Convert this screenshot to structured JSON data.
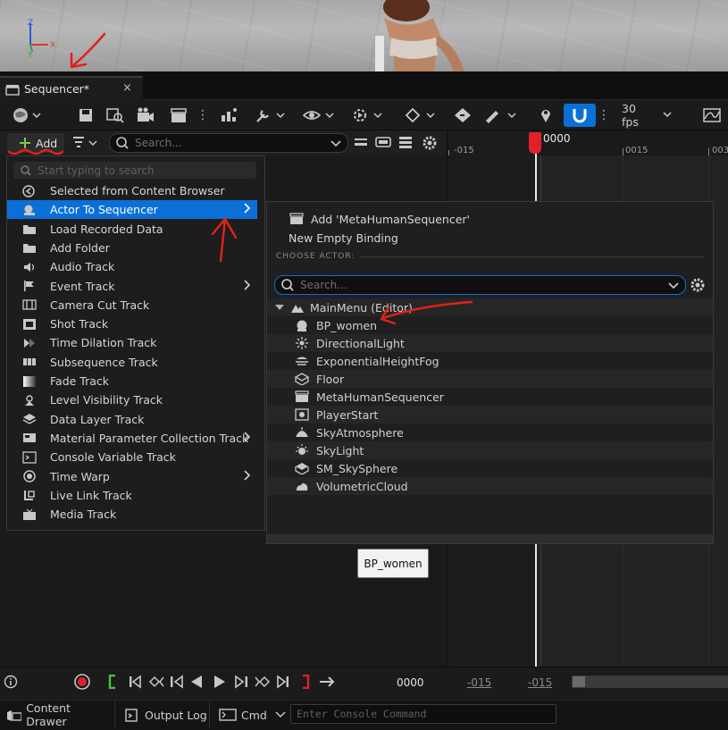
{
  "tab": {
    "title": "Sequencer*",
    "close": "×"
  },
  "toolbar": {
    "fps": "30 fps"
  },
  "filter_bar": {
    "add_label": "Add",
    "search_placeholder": "Search..."
  },
  "timeline": {
    "current_frame": "0000",
    "ruler_ticks": [
      "-015",
      "0015",
      "003"
    ]
  },
  "add_menu": {
    "search_placeholder": "Start typing to search",
    "items": [
      {
        "label": "Selected from Content Browser",
        "icon": "content-browser-icon",
        "submenu": false
      },
      {
        "label": "Actor To Sequencer",
        "icon": "actor-icon",
        "submenu": true
      },
      {
        "label": "Load Recorded Data",
        "icon": "folder-icon",
        "submenu": false
      },
      {
        "label": "Add Folder",
        "icon": "folder-icon",
        "submenu": false
      },
      {
        "label": "Audio Track",
        "icon": "speaker-icon",
        "submenu": false
      },
      {
        "label": "Event Track",
        "icon": "flag-icon",
        "submenu": true
      },
      {
        "label": "Camera Cut Track",
        "icon": "camera-cut-icon",
        "submenu": false
      },
      {
        "label": "Shot Track",
        "icon": "film-icon",
        "submenu": false
      },
      {
        "label": "Time Dilation Track",
        "icon": "time-dilation-icon",
        "submenu": false
      },
      {
        "label": "Subsequence Track",
        "icon": "subsequence-icon",
        "submenu": false
      },
      {
        "label": "Fade Track",
        "icon": "fade-icon",
        "submenu": false
      },
      {
        "label": "Level Visibility Track",
        "icon": "level-visibility-icon",
        "submenu": false
      },
      {
        "label": "Data Layer Track",
        "icon": "layers-icon",
        "submenu": false
      },
      {
        "label": "Material Parameter Collection Track",
        "icon": "material-icon",
        "submenu": true
      },
      {
        "label": "Console Variable Track",
        "icon": "console-icon",
        "submenu": false
      },
      {
        "label": "Time Warp",
        "icon": "clock-icon",
        "submenu": true
      },
      {
        "label": "Live Link Track",
        "icon": "live-link-icon",
        "submenu": false
      },
      {
        "label": "Media Track",
        "icon": "tv-icon",
        "submenu": false
      }
    ]
  },
  "actor_menu": {
    "add_sequence": "Add 'MetaHumanSequencer'",
    "new_binding": "New Empty Binding",
    "choose_actor_header": "CHOOSE ACTOR:",
    "search_placeholder": "Search...",
    "group": "MainMenu (Editor)",
    "actors": [
      "BP_women",
      "DirectionalLight",
      "ExponentialHeightFog",
      "Floor",
      "MetaHumanSequencer",
      "PlayerStart",
      "SkyAtmosphere",
      "SkyLight",
      "SM_SkySphere",
      "VolumetricCloud"
    ]
  },
  "tooltip": "BP_women",
  "transport": {
    "frame": "0000",
    "range_start": "-015",
    "range_end": "-015"
  },
  "statusbar": {
    "content_drawer": "Content Drawer",
    "output_log": "Output Log",
    "cmd": "Cmd",
    "console_placeholder": "Enter Console Command"
  },
  "colors": {
    "accent": "#0a70d8",
    "selected_row": "#0a70d8",
    "playhead": "#e0212a",
    "annotation": "#e0211c"
  }
}
